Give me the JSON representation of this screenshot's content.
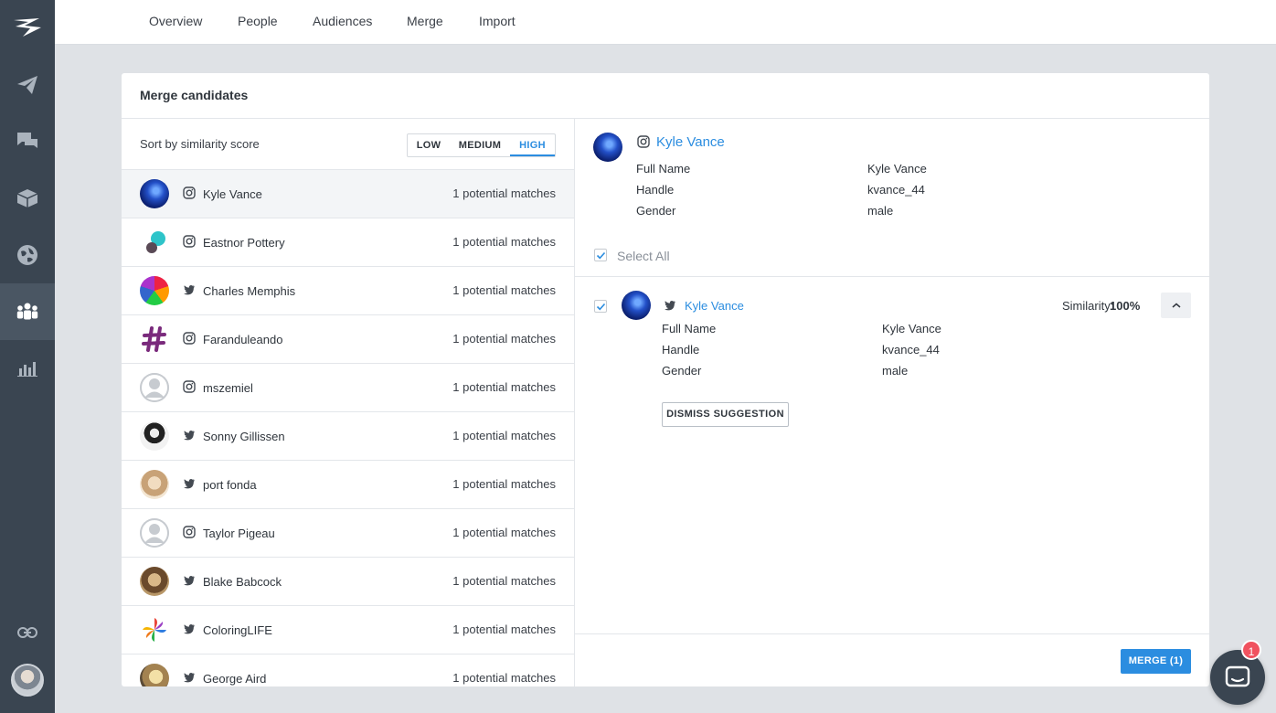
{
  "sidebar": {
    "items": [
      {
        "icon": "logo-icon"
      },
      {
        "icon": "paper-plane-icon"
      },
      {
        "icon": "chat-bubbles-icon"
      },
      {
        "icon": "box-icon"
      },
      {
        "icon": "globe-icon"
      },
      {
        "icon": "people-icon",
        "active": true
      },
      {
        "icon": "bar-chart-icon"
      },
      {
        "icon": "link-icon"
      }
    ]
  },
  "topnav": {
    "tabs": [
      {
        "label": "Overview"
      },
      {
        "label": "People"
      },
      {
        "label": "Audiences"
      },
      {
        "label": "Merge"
      },
      {
        "label": "Import"
      }
    ]
  },
  "card": {
    "title": "Merge candidates",
    "sort_label": "Sort by similarity score",
    "levels": {
      "low": "LOW",
      "medium": "MEDIUM",
      "high": "HIGH",
      "selected": "HIGH"
    }
  },
  "candidates": [
    {
      "name": "Kyle Vance",
      "network": "instagram",
      "matches": "1 potential matches",
      "selected": true
    },
    {
      "name": "Eastnor Pottery",
      "network": "instagram",
      "matches": "1 potential matches"
    },
    {
      "name": "Charles Memphis",
      "network": "twitter",
      "matches": "1 potential matches"
    },
    {
      "name": "Faranduleando",
      "network": "instagram",
      "matches": "1 potential matches"
    },
    {
      "name": "mszemiel",
      "network": "instagram",
      "matches": "1 potential matches"
    },
    {
      "name": "Sonny Gillissen",
      "network": "twitter",
      "matches": "1 potential matches"
    },
    {
      "name": "port fonda",
      "network": "twitter",
      "matches": "1 potential matches"
    },
    {
      "name": "Taylor Pigeau",
      "network": "instagram",
      "matches": "1 potential matches"
    },
    {
      "name": "Blake Babcock",
      "network": "twitter",
      "matches": "1 potential matches"
    },
    {
      "name": "ColoringLIFE",
      "network": "twitter",
      "matches": "1 potential matches"
    },
    {
      "name": "George Aird",
      "network": "twitter",
      "matches": "1 potential matches"
    }
  ],
  "primary": {
    "name": "Kyle Vance",
    "network": "instagram",
    "fields": [
      {
        "label": "Full Name",
        "value": "Kyle Vance"
      },
      {
        "label": "Handle",
        "value": "kvance_44"
      },
      {
        "label": "Gender",
        "value": "male"
      }
    ],
    "select_all": "Select All",
    "select_all_checked": true
  },
  "suggestion": {
    "name": "Kyle Vance",
    "network": "twitter",
    "checked": true,
    "similarity_label": "Similarity:",
    "similarity_value": "100%",
    "fields": [
      {
        "label": "Full Name",
        "value": "Kyle Vance"
      },
      {
        "label": "Handle",
        "value": "kvance_44"
      },
      {
        "label": "Gender",
        "value": "male"
      }
    ],
    "dismiss_label": "DISMISS SUGGESTION"
  },
  "footer": {
    "merge_label": "MERGE (1)"
  },
  "chat": {
    "badge_count": "1"
  },
  "colors": {
    "accent": "#2b8de0",
    "sidebar": "#3a4551",
    "badge": "#f0525f"
  }
}
